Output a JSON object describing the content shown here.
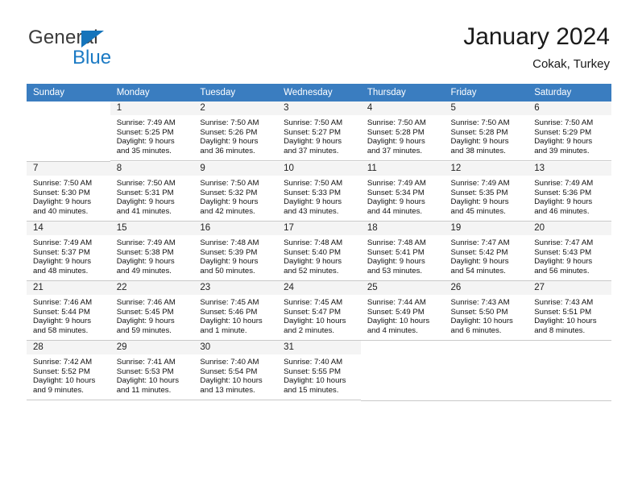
{
  "brand": {
    "name_part1": "General",
    "name_part2": "Blue",
    "accent_color": "#1b7ac4",
    "triangle_color": "#1574bb"
  },
  "header": {
    "title": "January 2024",
    "subtitle": "Cokak, Turkey"
  },
  "calendar": {
    "header_bg": "#3a7dc0",
    "weekdays": [
      "Sunday",
      "Monday",
      "Tuesday",
      "Wednesday",
      "Thursday",
      "Friday",
      "Saturday"
    ],
    "weeks": [
      [
        {
          "day": "",
          "sunrise": "",
          "sunset": "",
          "daylight1": "",
          "daylight2": ""
        },
        {
          "day": "1",
          "sunrise": "Sunrise: 7:49 AM",
          "sunset": "Sunset: 5:25 PM",
          "daylight1": "Daylight: 9 hours",
          "daylight2": "and 35 minutes."
        },
        {
          "day": "2",
          "sunrise": "Sunrise: 7:50 AM",
          "sunset": "Sunset: 5:26 PM",
          "daylight1": "Daylight: 9 hours",
          "daylight2": "and 36 minutes."
        },
        {
          "day": "3",
          "sunrise": "Sunrise: 7:50 AM",
          "sunset": "Sunset: 5:27 PM",
          "daylight1": "Daylight: 9 hours",
          "daylight2": "and 37 minutes."
        },
        {
          "day": "4",
          "sunrise": "Sunrise: 7:50 AM",
          "sunset": "Sunset: 5:28 PM",
          "daylight1": "Daylight: 9 hours",
          "daylight2": "and 37 minutes."
        },
        {
          "day": "5",
          "sunrise": "Sunrise: 7:50 AM",
          "sunset": "Sunset: 5:28 PM",
          "daylight1": "Daylight: 9 hours",
          "daylight2": "and 38 minutes."
        },
        {
          "day": "6",
          "sunrise": "Sunrise: 7:50 AM",
          "sunset": "Sunset: 5:29 PM",
          "daylight1": "Daylight: 9 hours",
          "daylight2": "and 39 minutes."
        }
      ],
      [
        {
          "day": "7",
          "sunrise": "Sunrise: 7:50 AM",
          "sunset": "Sunset: 5:30 PM",
          "daylight1": "Daylight: 9 hours",
          "daylight2": "and 40 minutes."
        },
        {
          "day": "8",
          "sunrise": "Sunrise: 7:50 AM",
          "sunset": "Sunset: 5:31 PM",
          "daylight1": "Daylight: 9 hours",
          "daylight2": "and 41 minutes."
        },
        {
          "day": "9",
          "sunrise": "Sunrise: 7:50 AM",
          "sunset": "Sunset: 5:32 PM",
          "daylight1": "Daylight: 9 hours",
          "daylight2": "and 42 minutes."
        },
        {
          "day": "10",
          "sunrise": "Sunrise: 7:50 AM",
          "sunset": "Sunset: 5:33 PM",
          "daylight1": "Daylight: 9 hours",
          "daylight2": "and 43 minutes."
        },
        {
          "day": "11",
          "sunrise": "Sunrise: 7:49 AM",
          "sunset": "Sunset: 5:34 PM",
          "daylight1": "Daylight: 9 hours",
          "daylight2": "and 44 minutes."
        },
        {
          "day": "12",
          "sunrise": "Sunrise: 7:49 AM",
          "sunset": "Sunset: 5:35 PM",
          "daylight1": "Daylight: 9 hours",
          "daylight2": "and 45 minutes."
        },
        {
          "day": "13",
          "sunrise": "Sunrise: 7:49 AM",
          "sunset": "Sunset: 5:36 PM",
          "daylight1": "Daylight: 9 hours",
          "daylight2": "and 46 minutes."
        }
      ],
      [
        {
          "day": "14",
          "sunrise": "Sunrise: 7:49 AM",
          "sunset": "Sunset: 5:37 PM",
          "daylight1": "Daylight: 9 hours",
          "daylight2": "and 48 minutes."
        },
        {
          "day": "15",
          "sunrise": "Sunrise: 7:49 AM",
          "sunset": "Sunset: 5:38 PM",
          "daylight1": "Daylight: 9 hours",
          "daylight2": "and 49 minutes."
        },
        {
          "day": "16",
          "sunrise": "Sunrise: 7:48 AM",
          "sunset": "Sunset: 5:39 PM",
          "daylight1": "Daylight: 9 hours",
          "daylight2": "and 50 minutes."
        },
        {
          "day": "17",
          "sunrise": "Sunrise: 7:48 AM",
          "sunset": "Sunset: 5:40 PM",
          "daylight1": "Daylight: 9 hours",
          "daylight2": "and 52 minutes."
        },
        {
          "day": "18",
          "sunrise": "Sunrise: 7:48 AM",
          "sunset": "Sunset: 5:41 PM",
          "daylight1": "Daylight: 9 hours",
          "daylight2": "and 53 minutes."
        },
        {
          "day": "19",
          "sunrise": "Sunrise: 7:47 AM",
          "sunset": "Sunset: 5:42 PM",
          "daylight1": "Daylight: 9 hours",
          "daylight2": "and 54 minutes."
        },
        {
          "day": "20",
          "sunrise": "Sunrise: 7:47 AM",
          "sunset": "Sunset: 5:43 PM",
          "daylight1": "Daylight: 9 hours",
          "daylight2": "and 56 minutes."
        }
      ],
      [
        {
          "day": "21",
          "sunrise": "Sunrise: 7:46 AM",
          "sunset": "Sunset: 5:44 PM",
          "daylight1": "Daylight: 9 hours",
          "daylight2": "and 58 minutes."
        },
        {
          "day": "22",
          "sunrise": "Sunrise: 7:46 AM",
          "sunset": "Sunset: 5:45 PM",
          "daylight1": "Daylight: 9 hours",
          "daylight2": "and 59 minutes."
        },
        {
          "day": "23",
          "sunrise": "Sunrise: 7:45 AM",
          "sunset": "Sunset: 5:46 PM",
          "daylight1": "Daylight: 10 hours",
          "daylight2": "and 1 minute."
        },
        {
          "day": "24",
          "sunrise": "Sunrise: 7:45 AM",
          "sunset": "Sunset: 5:47 PM",
          "daylight1": "Daylight: 10 hours",
          "daylight2": "and 2 minutes."
        },
        {
          "day": "25",
          "sunrise": "Sunrise: 7:44 AM",
          "sunset": "Sunset: 5:49 PM",
          "daylight1": "Daylight: 10 hours",
          "daylight2": "and 4 minutes."
        },
        {
          "day": "26",
          "sunrise": "Sunrise: 7:43 AM",
          "sunset": "Sunset: 5:50 PM",
          "daylight1": "Daylight: 10 hours",
          "daylight2": "and 6 minutes."
        },
        {
          "day": "27",
          "sunrise": "Sunrise: 7:43 AM",
          "sunset": "Sunset: 5:51 PM",
          "daylight1": "Daylight: 10 hours",
          "daylight2": "and 8 minutes."
        }
      ],
      [
        {
          "day": "28",
          "sunrise": "Sunrise: 7:42 AM",
          "sunset": "Sunset: 5:52 PM",
          "daylight1": "Daylight: 10 hours",
          "daylight2": "and 9 minutes."
        },
        {
          "day": "29",
          "sunrise": "Sunrise: 7:41 AM",
          "sunset": "Sunset: 5:53 PM",
          "daylight1": "Daylight: 10 hours",
          "daylight2": "and 11 minutes."
        },
        {
          "day": "30",
          "sunrise": "Sunrise: 7:40 AM",
          "sunset": "Sunset: 5:54 PM",
          "daylight1": "Daylight: 10 hours",
          "daylight2": "and 13 minutes."
        },
        {
          "day": "31",
          "sunrise": "Sunrise: 7:40 AM",
          "sunset": "Sunset: 5:55 PM",
          "daylight1": "Daylight: 10 hours",
          "daylight2": "and 15 minutes."
        },
        {
          "day": "",
          "sunrise": "",
          "sunset": "",
          "daylight1": "",
          "daylight2": ""
        },
        {
          "day": "",
          "sunrise": "",
          "sunset": "",
          "daylight1": "",
          "daylight2": ""
        },
        {
          "day": "",
          "sunrise": "",
          "sunset": "",
          "daylight1": "",
          "daylight2": ""
        }
      ]
    ]
  }
}
